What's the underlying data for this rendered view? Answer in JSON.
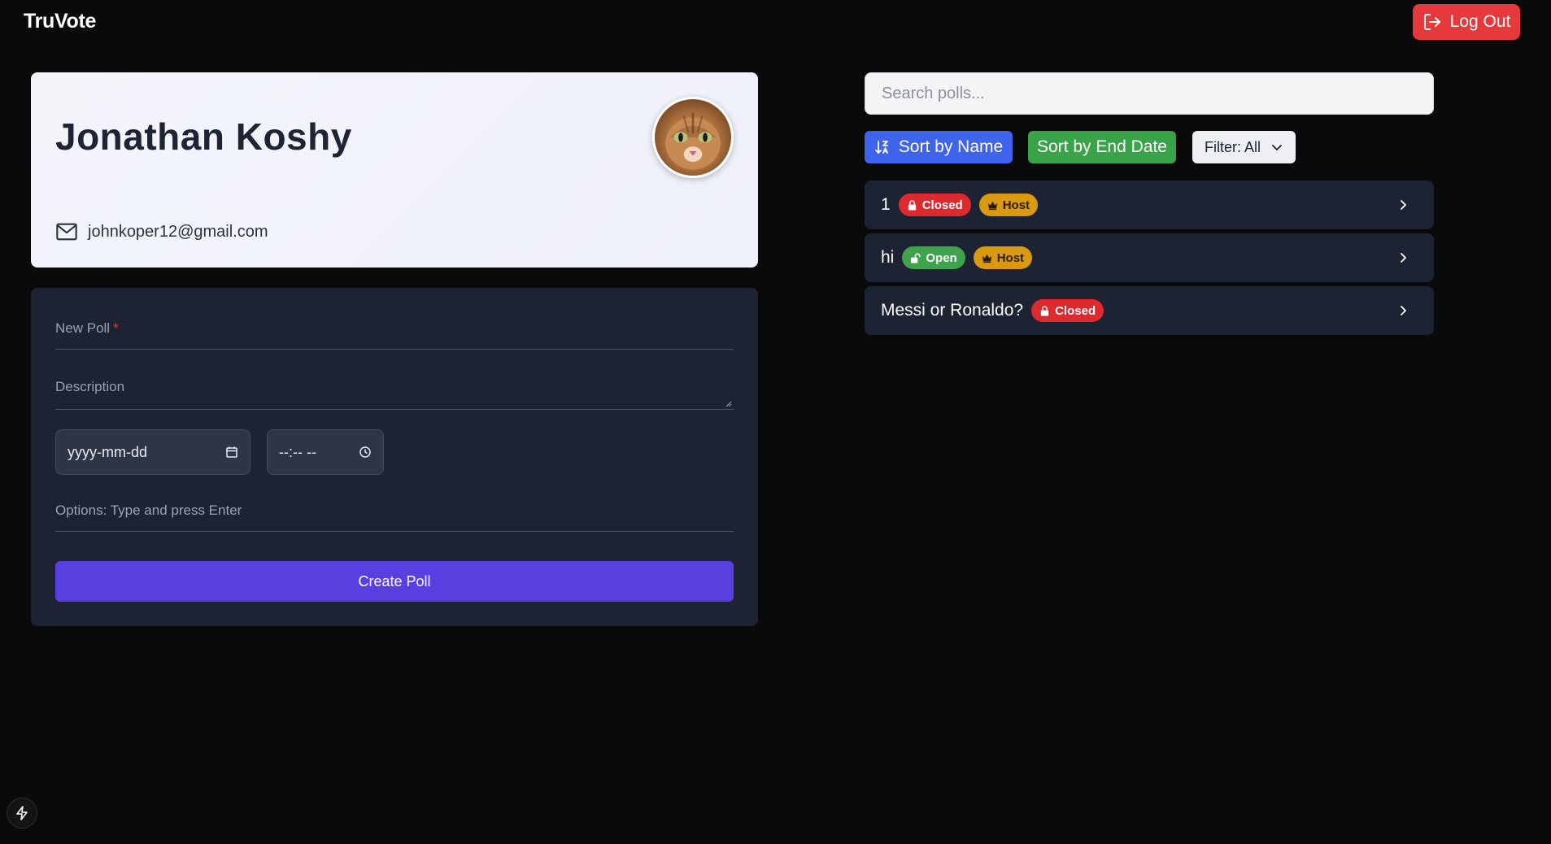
{
  "app": {
    "title": "TruVote"
  },
  "header": {
    "logout_label": "Log Out"
  },
  "profile": {
    "name": "Jonathan Koshy",
    "email": "johnkoper12@gmail.com",
    "avatar": "cat-photo"
  },
  "poll_form": {
    "title_placeholder": "New Poll",
    "title_required_marker": "*",
    "description_placeholder": "Description",
    "date_value": "yyyy-mm-dd",
    "time_value": "--:-- --",
    "options_placeholder": "Options: Type and press Enter",
    "submit_label": "Create Poll"
  },
  "polls_panel": {
    "search_placeholder": "Search polls...",
    "sort_name_label": "Sort by Name",
    "sort_date_label": "Sort by End Date",
    "filter_label": "Filter: All",
    "polls": [
      {
        "name": "1",
        "status": "Closed",
        "host": "Host"
      },
      {
        "name": "hi",
        "status": "Open",
        "host": "Host"
      },
      {
        "name": "Messi or Ronaldo?",
        "status": "Closed"
      }
    ]
  },
  "colors": {
    "background": "#0a0a0a",
    "card_dark": "#1e2333",
    "logout": "#e5393c",
    "primary": "#5a3fe0",
    "sort_name": "#3e63ec",
    "sort_date": "#38a348",
    "closed": "#dc2a2e",
    "open": "#3fa34d",
    "host": "#d99a12"
  }
}
